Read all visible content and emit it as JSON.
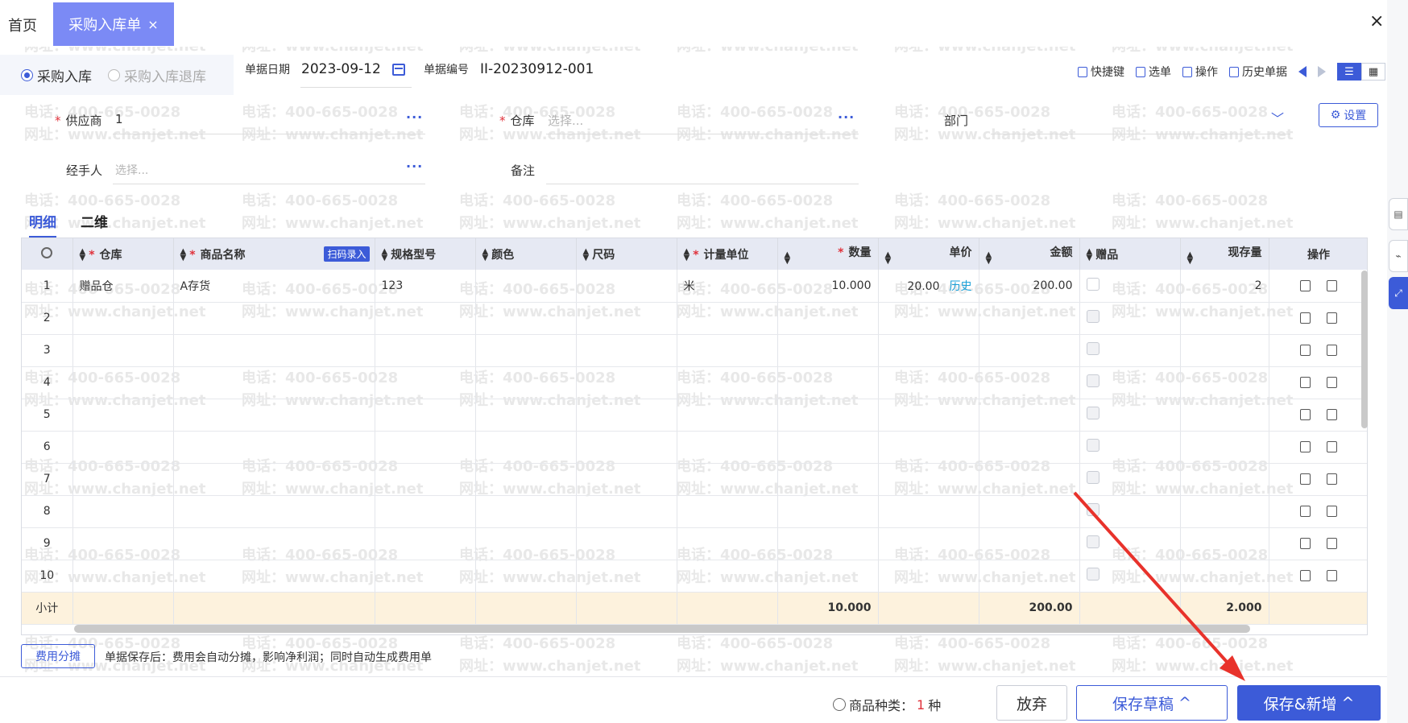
{
  "tabs": {
    "home": "首页",
    "active": "采购入库单",
    "close_glyph": "×",
    "window_close": "×"
  },
  "header": {
    "radio_in": "采购入库",
    "radio_return": "采购入库退库",
    "date_label": "单据日期",
    "date_value": "2023-09-12",
    "no_label": "单据编号",
    "no_value": "II-20230912-001",
    "toolbar": {
      "shortcut": "快捷键",
      "select": "选单",
      "operate": "操作",
      "history": "历史单据"
    }
  },
  "form": {
    "supplier_label": "供应商",
    "supplier_value": "1",
    "warehouse_label": "仓库",
    "warehouse_placeholder": "选择...",
    "dept_label": "部门",
    "settings": "设置",
    "handler_label": "经手人",
    "handler_placeholder": "选择...",
    "remark_label": "备注",
    "more": "···"
  },
  "grid_tabs": [
    "明细",
    "二维"
  ],
  "table": {
    "columns": {
      "warehouse": "仓库",
      "product": "商品名称",
      "scan": "扫码录入",
      "spec": "规格型号",
      "color": "颜色",
      "size": "尺码",
      "unit": "计量单位",
      "qty": "数量",
      "price": "单价",
      "amount": "金额",
      "gift": "赠品",
      "stock": "现存量",
      "ops": "操作"
    },
    "row1": {
      "index": "1",
      "warehouse": "赠品仓",
      "product": "A存货",
      "spec": "123",
      "unit": "米",
      "qty": "10.000",
      "price": "20.00",
      "history": "历史",
      "amount": "200.00",
      "stock": "2"
    },
    "row_indices": [
      "2",
      "3",
      "4",
      "5",
      "6",
      "7",
      "8",
      "9",
      "10"
    ],
    "subtotal": {
      "label": "小计",
      "qty": "10.000",
      "amount": "200.00",
      "stock": "2.000"
    }
  },
  "fee": {
    "button": "费用分摊",
    "note": "单据保存后：费用会自动分摊，影响净利润；同时自动生成费用单"
  },
  "footer": {
    "kinds_label": "商品种类：",
    "kinds_count": "1",
    "kinds_unit": "种",
    "abandon": "放弃",
    "draft": "保存草稿",
    "save_new": "保存&新增",
    "caret": "^"
  },
  "watermark": {
    "phone": "电话：400-665-0028",
    "site": "网址：www.chanjet.net"
  },
  "colors": {
    "accent": "#3c5bd8",
    "tab_active": "#7b8af5",
    "subtotal_bg": "#fdf2dd",
    "required": "#e0313a",
    "arrow": "#e8322b"
  }
}
